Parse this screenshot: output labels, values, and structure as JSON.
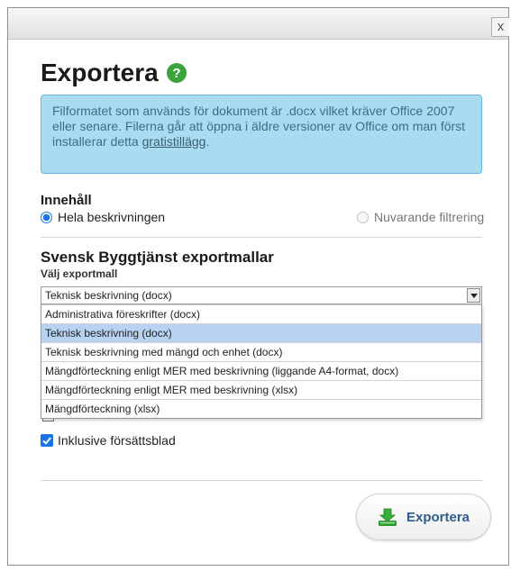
{
  "window": {
    "close_label": "x"
  },
  "dialog": {
    "title": "Exportera",
    "info": {
      "text": "Filformatet som används för dokument är .docx vilket kräver Office 2007 eller senare. Filerna går att öppna i äldre versioner av Office om man först installerar detta ",
      "link": "gratistillägg",
      "suffix": "."
    },
    "content": {
      "label": "Innehåll",
      "options": [
        {
          "label": "Hela beskrivningen",
          "checked": true
        },
        {
          "label": "Nuvarande filtrering",
          "checked": false
        }
      ]
    },
    "templates": {
      "title": "Svensk Byggtjänst exportmallar",
      "select_label": "Välj exportmall",
      "selected": "Teknisk beskrivning (docx)",
      "options": [
        "Administrativa föreskrifter (docx)",
        "Teknisk beskrivning (docx)",
        "Teknisk beskrivning med mängd och enhet (docx)",
        "Mängdförteckning enligt MER med beskrivning (liggande A4-format, docx)",
        "Mängdförteckning enligt MER med beskrivning (xlsx)",
        "Mängdförteckning (xlsx)"
      ],
      "highlighted_index": 1
    },
    "cover_sheet": {
      "label": "Inklusive försättsblad",
      "checked": true
    },
    "export_button": "Exportera"
  },
  "icons": {
    "help": "help-icon",
    "close": "close-icon",
    "download": "download-icon",
    "dropdown": "chevron-down-icon"
  },
  "colors": {
    "accent": "#1a73e8",
    "help_green": "#3aa33a",
    "info_bg": "#a9dcf1",
    "info_border": "#62b6e0",
    "highlight": "#b8d2f1"
  }
}
